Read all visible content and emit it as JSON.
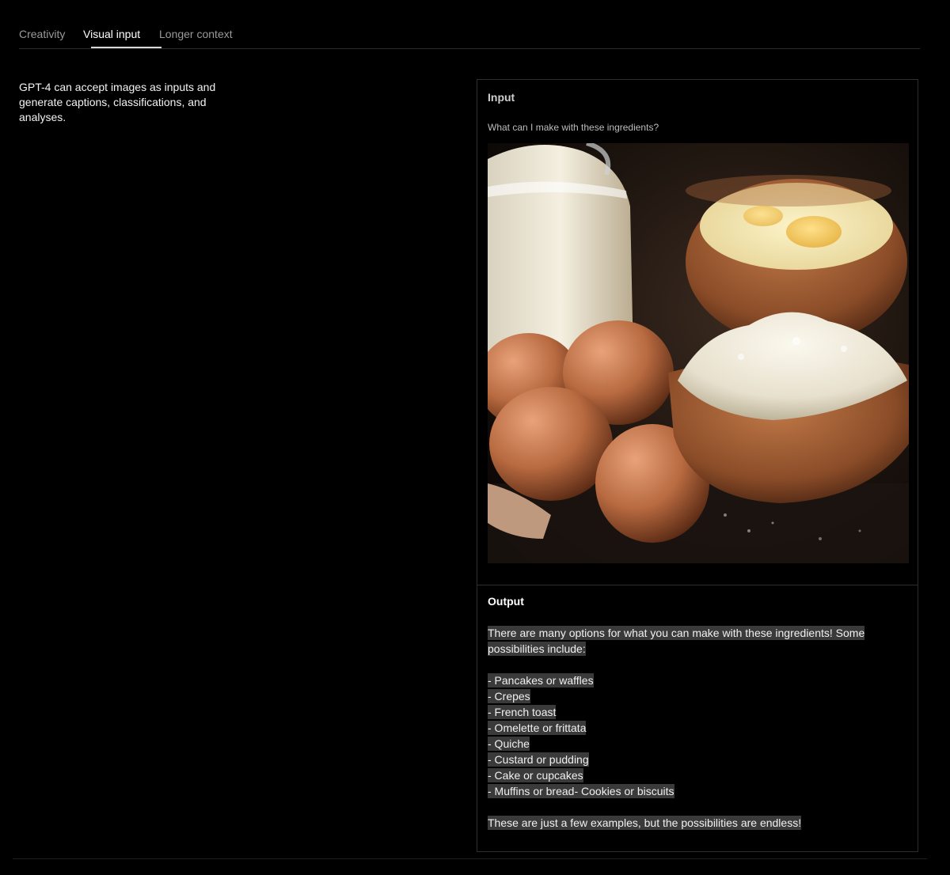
{
  "tabs": [
    {
      "label": "Creativity",
      "active": false
    },
    {
      "label": "Visual input",
      "active": true
    },
    {
      "label": "Longer context",
      "active": false
    }
  ],
  "intro": {
    "text": "GPT-4 can accept images as inputs and generate captions, classifications, and analyses."
  },
  "input": {
    "label": "Input",
    "prompt": "What can I make with these ingredients?",
    "image_subject": "milk-eggs-flour-photo"
  },
  "output": {
    "label": "Output",
    "intro_line1": "There are many options for what you can make with these ingredients! Some",
    "intro_line2": "possibilities include:",
    "items": [
      "- Pancakes or waffles",
      "- Crepes",
      "- French toast",
      "- Omelette or frittata",
      "- Quiche",
      "- Custard or pudding",
      "- Cake or cupcakes",
      "- Muffins or bread- Cookies or biscuits"
    ],
    "closing": "These are just a few examples, but the possibilities are endless!"
  },
  "colors": {
    "background": "#000000",
    "text": "#f0f0f0",
    "highlight": "#3a3a3a",
    "border": "#2e2e2e"
  }
}
